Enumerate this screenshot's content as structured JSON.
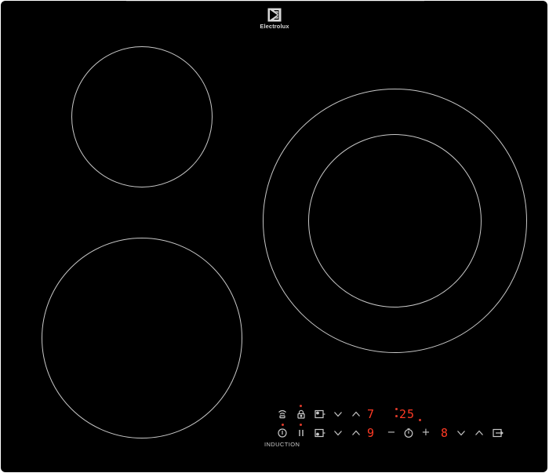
{
  "brand": {
    "name": "Electrolux",
    "logo_icon": "electrolux-logo-icon"
  },
  "cooktop": {
    "type_label": "INDUCTION",
    "surface_color": "#000000",
    "zone_outline_color": "#c8c8c8",
    "display_color": "#ff3a24",
    "zones": [
      {
        "id": "rear-left"
      },
      {
        "id": "front-left"
      },
      {
        "id": "right-outer"
      },
      {
        "id": "right-inner"
      }
    ]
  },
  "controls": {
    "top_row": {
      "wifi_icon": "wifi-hob-to-hood-icon",
      "lock_icon": "lock-icon",
      "timer_zone_icon": "zone-timer-icon",
      "down_icon": "chevron-down-icon",
      "up_icon": "chevron-up-icon",
      "power_level": "7",
      "timer_display": "25"
    },
    "bottom_row": {
      "power_icon": "power-icon",
      "pause_icon": "pause-icon",
      "zone_select_icon": "zone-select-icon",
      "left_power_level": "9",
      "minus_label": "−",
      "timer_icon": "timer-icon",
      "plus_label": "+",
      "right_power_level": "8",
      "bridge_icon": "bridge-zone-icon"
    }
  }
}
